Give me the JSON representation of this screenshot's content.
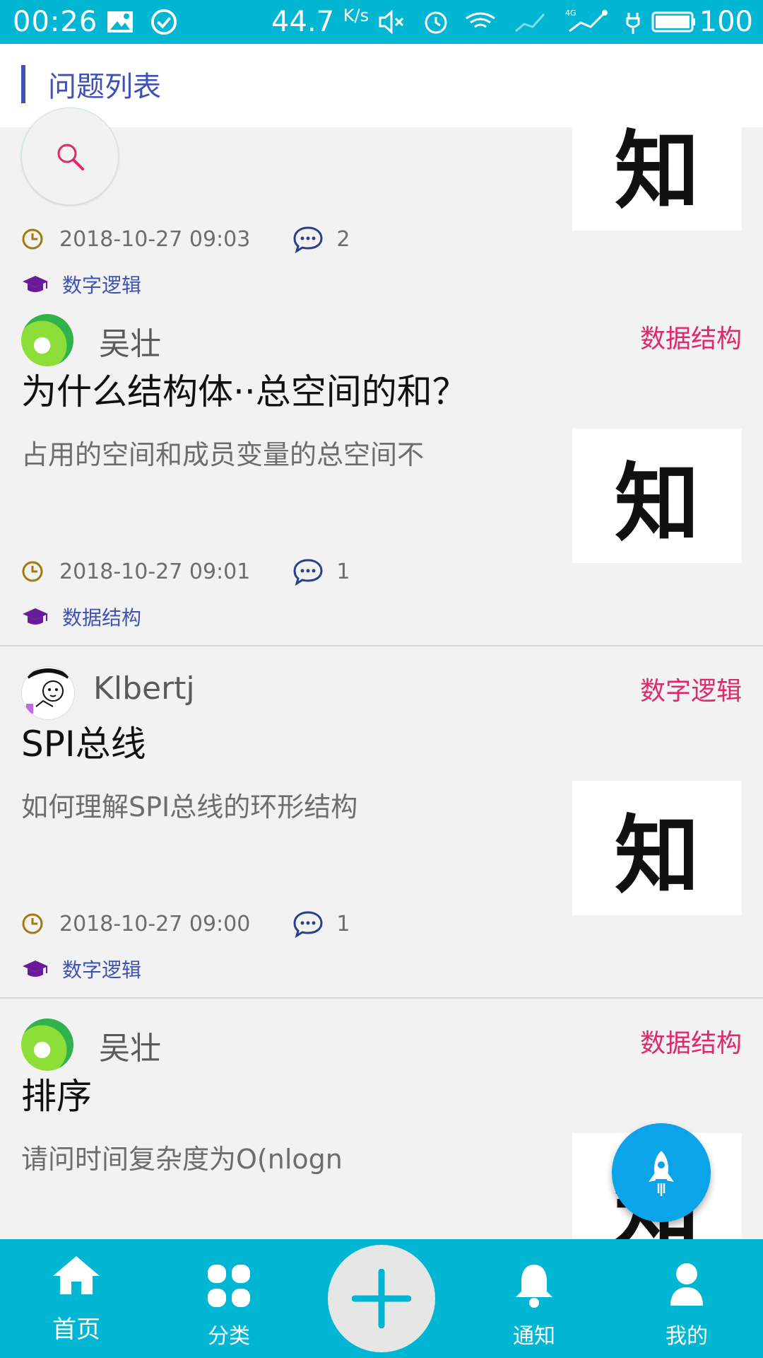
{
  "status_bar": {
    "time": "00:26",
    "speed": "44.7",
    "speed_unit": "K/s",
    "battery": "100"
  },
  "header": {
    "title": "问题列表"
  },
  "questions": [
    {
      "author": "",
      "category": "",
      "title": "",
      "description": "",
      "time": "2018-10-27 09:03",
      "comments": "2",
      "tag": "数字逻辑",
      "thumb_text": "知"
    },
    {
      "author": "吴壮",
      "category": "数据结构",
      "title": "为什么结构体··总空间的和？",
      "description": "占用的空间和成员变量的总空间不",
      "time": "2018-10-27 09:01",
      "comments": "1",
      "tag": "数据结构",
      "thumb_text": "知"
    },
    {
      "author": "Klbertj",
      "category": "数字逻辑",
      "title": "SPI总线",
      "description": "如何理解SPI总线的环形结构",
      "time": "2018-10-27 09:00",
      "comments": "1",
      "tag": "数字逻辑",
      "thumb_text": "知"
    },
    {
      "author": "吴壮",
      "category": "数据结构",
      "title": "排序",
      "description": "请问时间复杂度为O(nlogn",
      "thumb_text": "知"
    }
  ],
  "bottom_nav": {
    "home": "首页",
    "category": "分类",
    "notify": "通知",
    "mine": "我的"
  },
  "colors": {
    "primary": "#00b6d3",
    "accent_pink": "#e0286c",
    "indigo": "#3f51b5",
    "fab_blue": "#0ba4e8"
  }
}
